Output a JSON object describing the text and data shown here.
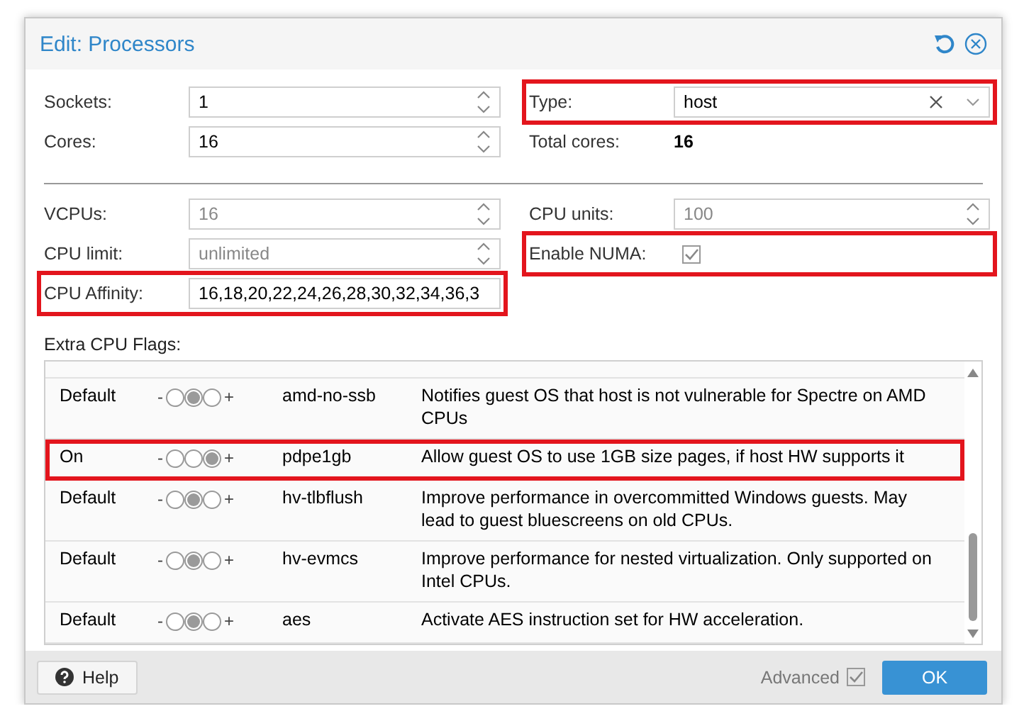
{
  "window": {
    "title": "Edit: Processors"
  },
  "basic": {
    "left": [
      {
        "label": "Sockets:",
        "value": "1",
        "kind": "spinner",
        "disabled": false,
        "highlighted": false
      },
      {
        "label": "Cores:",
        "value": "16",
        "kind": "spinner",
        "disabled": false,
        "highlighted": false
      }
    ],
    "right": [
      {
        "label": "Type:",
        "value": "host",
        "kind": "combo",
        "highlighted": true
      },
      {
        "label": "Total cores:",
        "value": "16",
        "kind": "display",
        "highlighted": false
      }
    ]
  },
  "advanced": {
    "left": [
      {
        "label": "VCPUs:",
        "value": "16",
        "kind": "spinner",
        "disabled": true,
        "highlighted": false
      },
      {
        "label": "CPU limit:",
        "value": "unlimited",
        "kind": "spinner",
        "disabled": true,
        "highlighted": false
      },
      {
        "label": "CPU Affinity:",
        "value": "16,18,20,22,24,26,28,30,32,34,36,3",
        "kind": "text",
        "highlighted": true
      }
    ],
    "right": [
      {
        "label": "CPU units:",
        "value": "100",
        "kind": "spinner",
        "disabled": true,
        "highlighted": false
      },
      {
        "label": "Enable NUMA:",
        "kind": "checkbox",
        "checked": true,
        "disabled": true,
        "highlighted": true
      }
    ]
  },
  "flags_label": "Extra CPU Flags:",
  "flags": [
    {
      "state": "Default",
      "minus": "-",
      "plus": "+",
      "switch": [
        {
          "selected": false
        },
        {
          "selected": true
        },
        {
          "selected": false
        }
      ],
      "name": "amd-no-ssb",
      "description": "Notifies guest OS that host is not vulnerable for Spectre on AMD CPUs",
      "highlighted": false
    },
    {
      "state": "On",
      "minus": "-",
      "plus": "+",
      "switch": [
        {
          "selected": false
        },
        {
          "selected": false
        },
        {
          "selected": true
        }
      ],
      "name": "pdpe1gb",
      "description": "Allow guest OS to use 1GB size pages, if host HW supports it",
      "highlighted": true
    },
    {
      "state": "Default",
      "minus": "-",
      "plus": "+",
      "switch": [
        {
          "selected": false
        },
        {
          "selected": true
        },
        {
          "selected": false
        }
      ],
      "name": "hv-tlbflush",
      "description": "Improve performance in overcommitted Windows guests. May lead to guest bluescreens on old CPUs.",
      "highlighted": false
    },
    {
      "state": "Default",
      "minus": "-",
      "plus": "+",
      "switch": [
        {
          "selected": false
        },
        {
          "selected": true
        },
        {
          "selected": false
        }
      ],
      "name": "hv-evmcs",
      "description": "Improve performance for nested virtualization. Only supported on Intel CPUs.",
      "highlighted": false
    },
    {
      "state": "Default",
      "minus": "-",
      "plus": "+",
      "switch": [
        {
          "selected": false
        },
        {
          "selected": true
        },
        {
          "selected": false
        }
      ],
      "name": "aes",
      "description": "Activate AES instruction set for HW acceleration.",
      "highlighted": false
    }
  ],
  "footer": {
    "help": "Help",
    "advanced": {
      "label": "Advanced",
      "checked": true
    },
    "ok": "OK"
  }
}
